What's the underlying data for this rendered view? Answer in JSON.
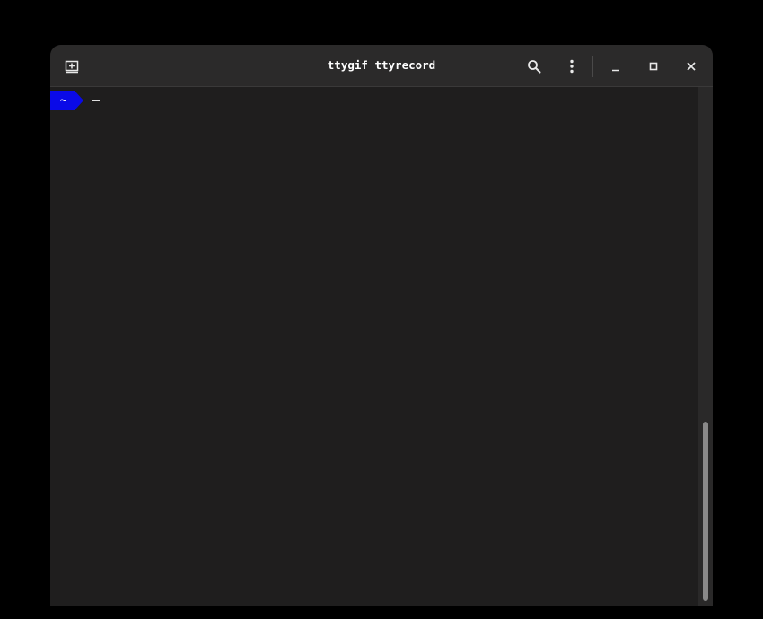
{
  "window": {
    "title": "ttygif ttyrecord"
  },
  "titlebar": {
    "buttons": [
      {
        "name": "new-tab",
        "icon": "new-tab-icon"
      },
      {
        "name": "search",
        "icon": "search-icon"
      },
      {
        "name": "menu",
        "icon": "kebab-menu-icon"
      },
      {
        "name": "minimize",
        "icon": "minimize-icon"
      },
      {
        "name": "maximize",
        "icon": "maximize-icon"
      },
      {
        "name": "close",
        "icon": "close-icon"
      }
    ]
  },
  "terminal": {
    "prompt_text": "~",
    "prompt_color": "#0a0ae8",
    "background_color": "#1f1e1e"
  },
  "scrollbar": {
    "position_fraction": 0.65
  }
}
